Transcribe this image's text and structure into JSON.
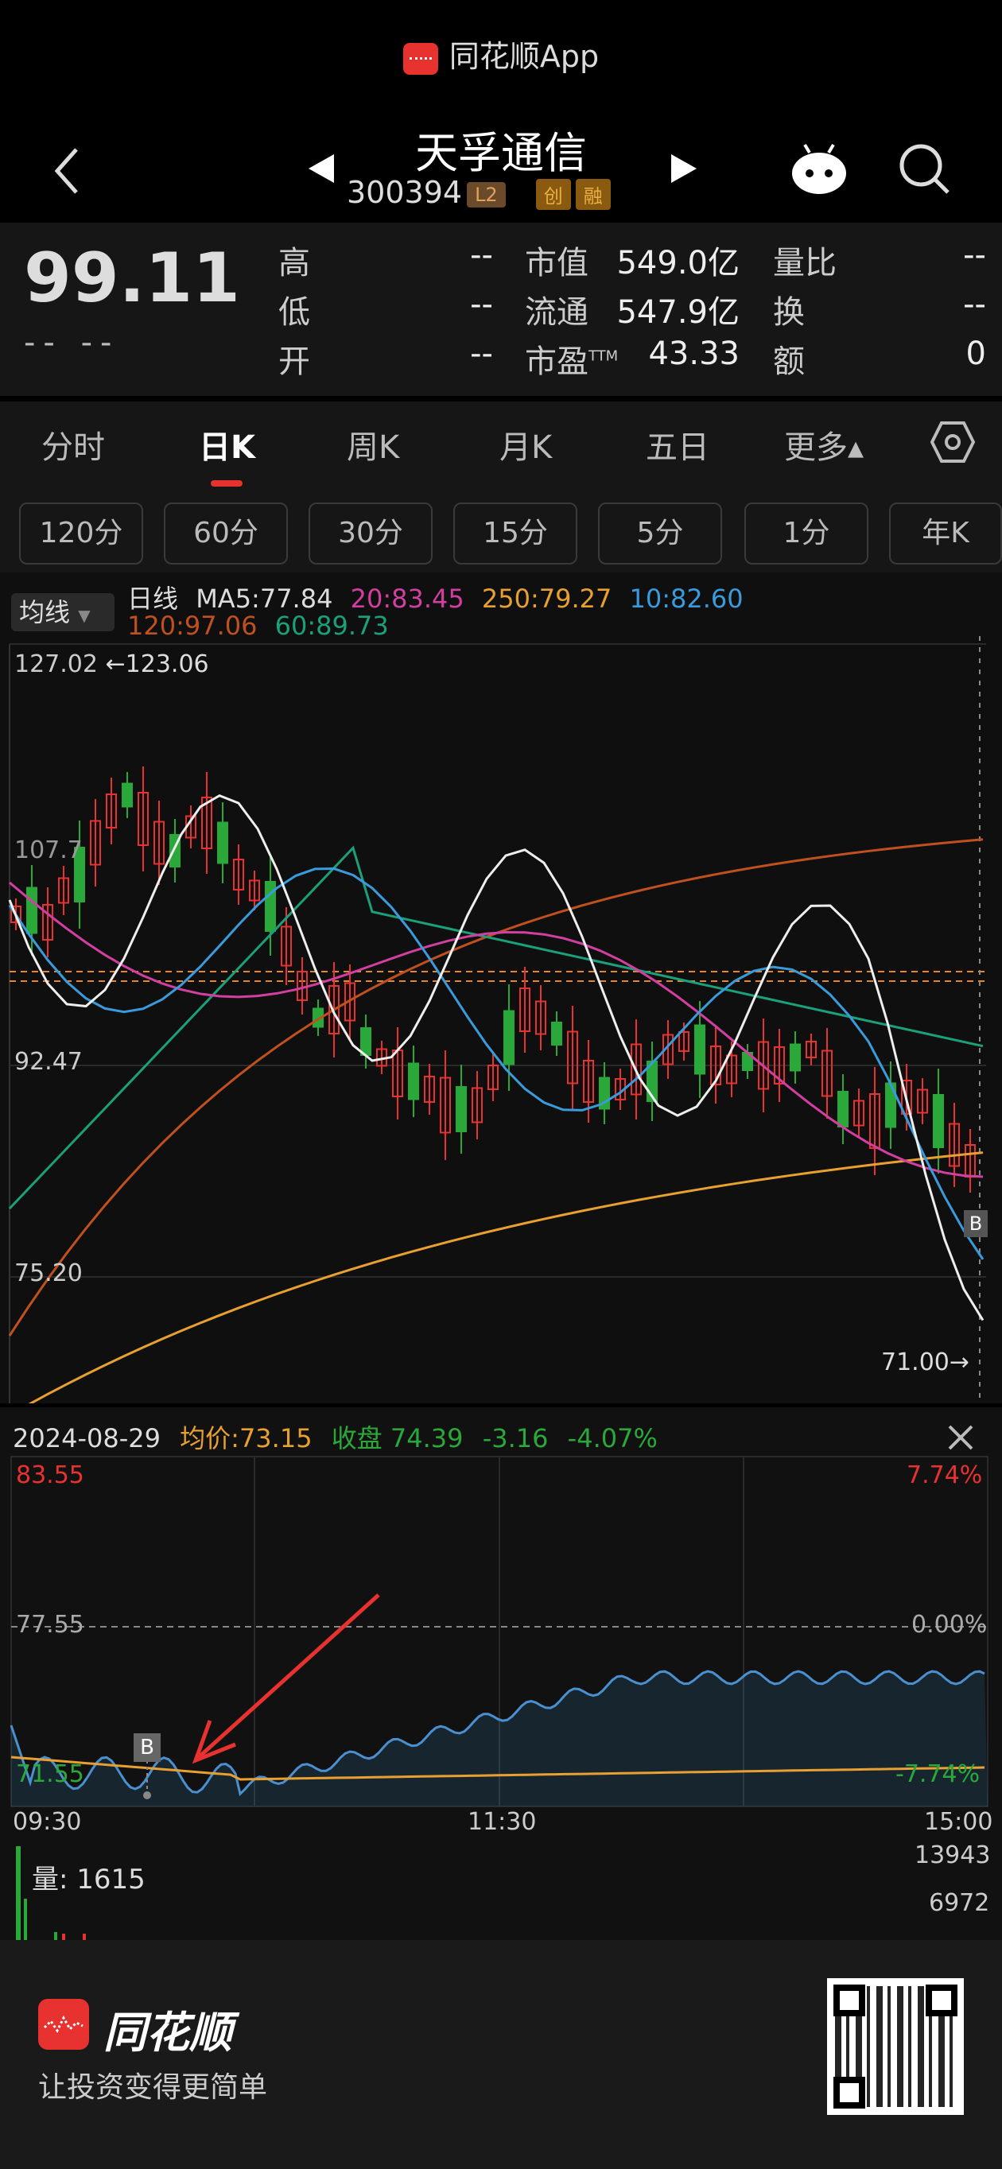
{
  "header": {
    "app_name": "同花顺App",
    "stock_name": "天孚通信",
    "stock_code": "300394",
    "tags": [
      "L2",
      "创",
      "融"
    ]
  },
  "quote": {
    "price": "99.11",
    "change_placeholder": "-- --",
    "high_label": "高",
    "high_value": "--",
    "low_label": "低",
    "low_value": "--",
    "open_label": "开",
    "open_value": "--",
    "mktcap_label": "市值",
    "mktcap_value": "549.0亿",
    "float_label": "流通",
    "float_value": "547.9亿",
    "pe_label": "市盈",
    "pe_superscript": "TTM",
    "pe_value": "43.33",
    "volratio_label": "量比",
    "volratio_value": "--",
    "turnover_label": "换",
    "turnover_value": "--",
    "amount_label": "额",
    "amount_value": "0"
  },
  "period_tabs": [
    "分时",
    "日K",
    "周K",
    "月K",
    "五日",
    "更多▴"
  ],
  "active_period": "日K",
  "intervals": [
    "120分",
    "60分",
    "30分",
    "15分",
    "5分",
    "1分",
    "年K"
  ],
  "kline": {
    "indicator_select": "均线",
    "ma_line_label": "日线",
    "ma5": "MA5:77.84",
    "ma20": "20:83.45",
    "ma250": "250:79.27",
    "ma10": "10:82.60",
    "ma120": "120:97.06",
    "ma60": "60:89.73",
    "y_top": "127.02",
    "high_marker": "←123.06",
    "y_mid": "92.47",
    "y_low": "75.20",
    "low_marker": "71.00→",
    "ref_tick": "107.7",
    "b_marker": "B",
    "colors": {
      "ma5": "#e8e8e8",
      "ma10": "#3a9bdc",
      "ma20": "#d23fa0",
      "ma60": "#1aa07a",
      "ma120": "#c0501e",
      "ma250": "#e8a030",
      "up": "#e8322f",
      "down": "#2aa83a"
    }
  },
  "intraday": {
    "date": "2024-08-29",
    "avg_label": "均价:",
    "avg_value": "73.15",
    "close_label": "收盘",
    "close_value": "74.39",
    "change": "-3.16",
    "change_pct": "-4.07%",
    "y_high": "83.55",
    "y_mid": "77.55",
    "y_low": "71.55",
    "pct_high": "7.74%",
    "pct_mid": "0.00%",
    "pct_low": "-7.74%",
    "time_start": "09:30",
    "time_mid": "11:30",
    "time_end": "15:00",
    "b_marker": "B",
    "volume_label": "量: 1615",
    "vol_max": "13943",
    "vol_mid": "6972"
  },
  "footer": {
    "brand": "同花顺",
    "slogan": "让投资变得更简单"
  }
}
